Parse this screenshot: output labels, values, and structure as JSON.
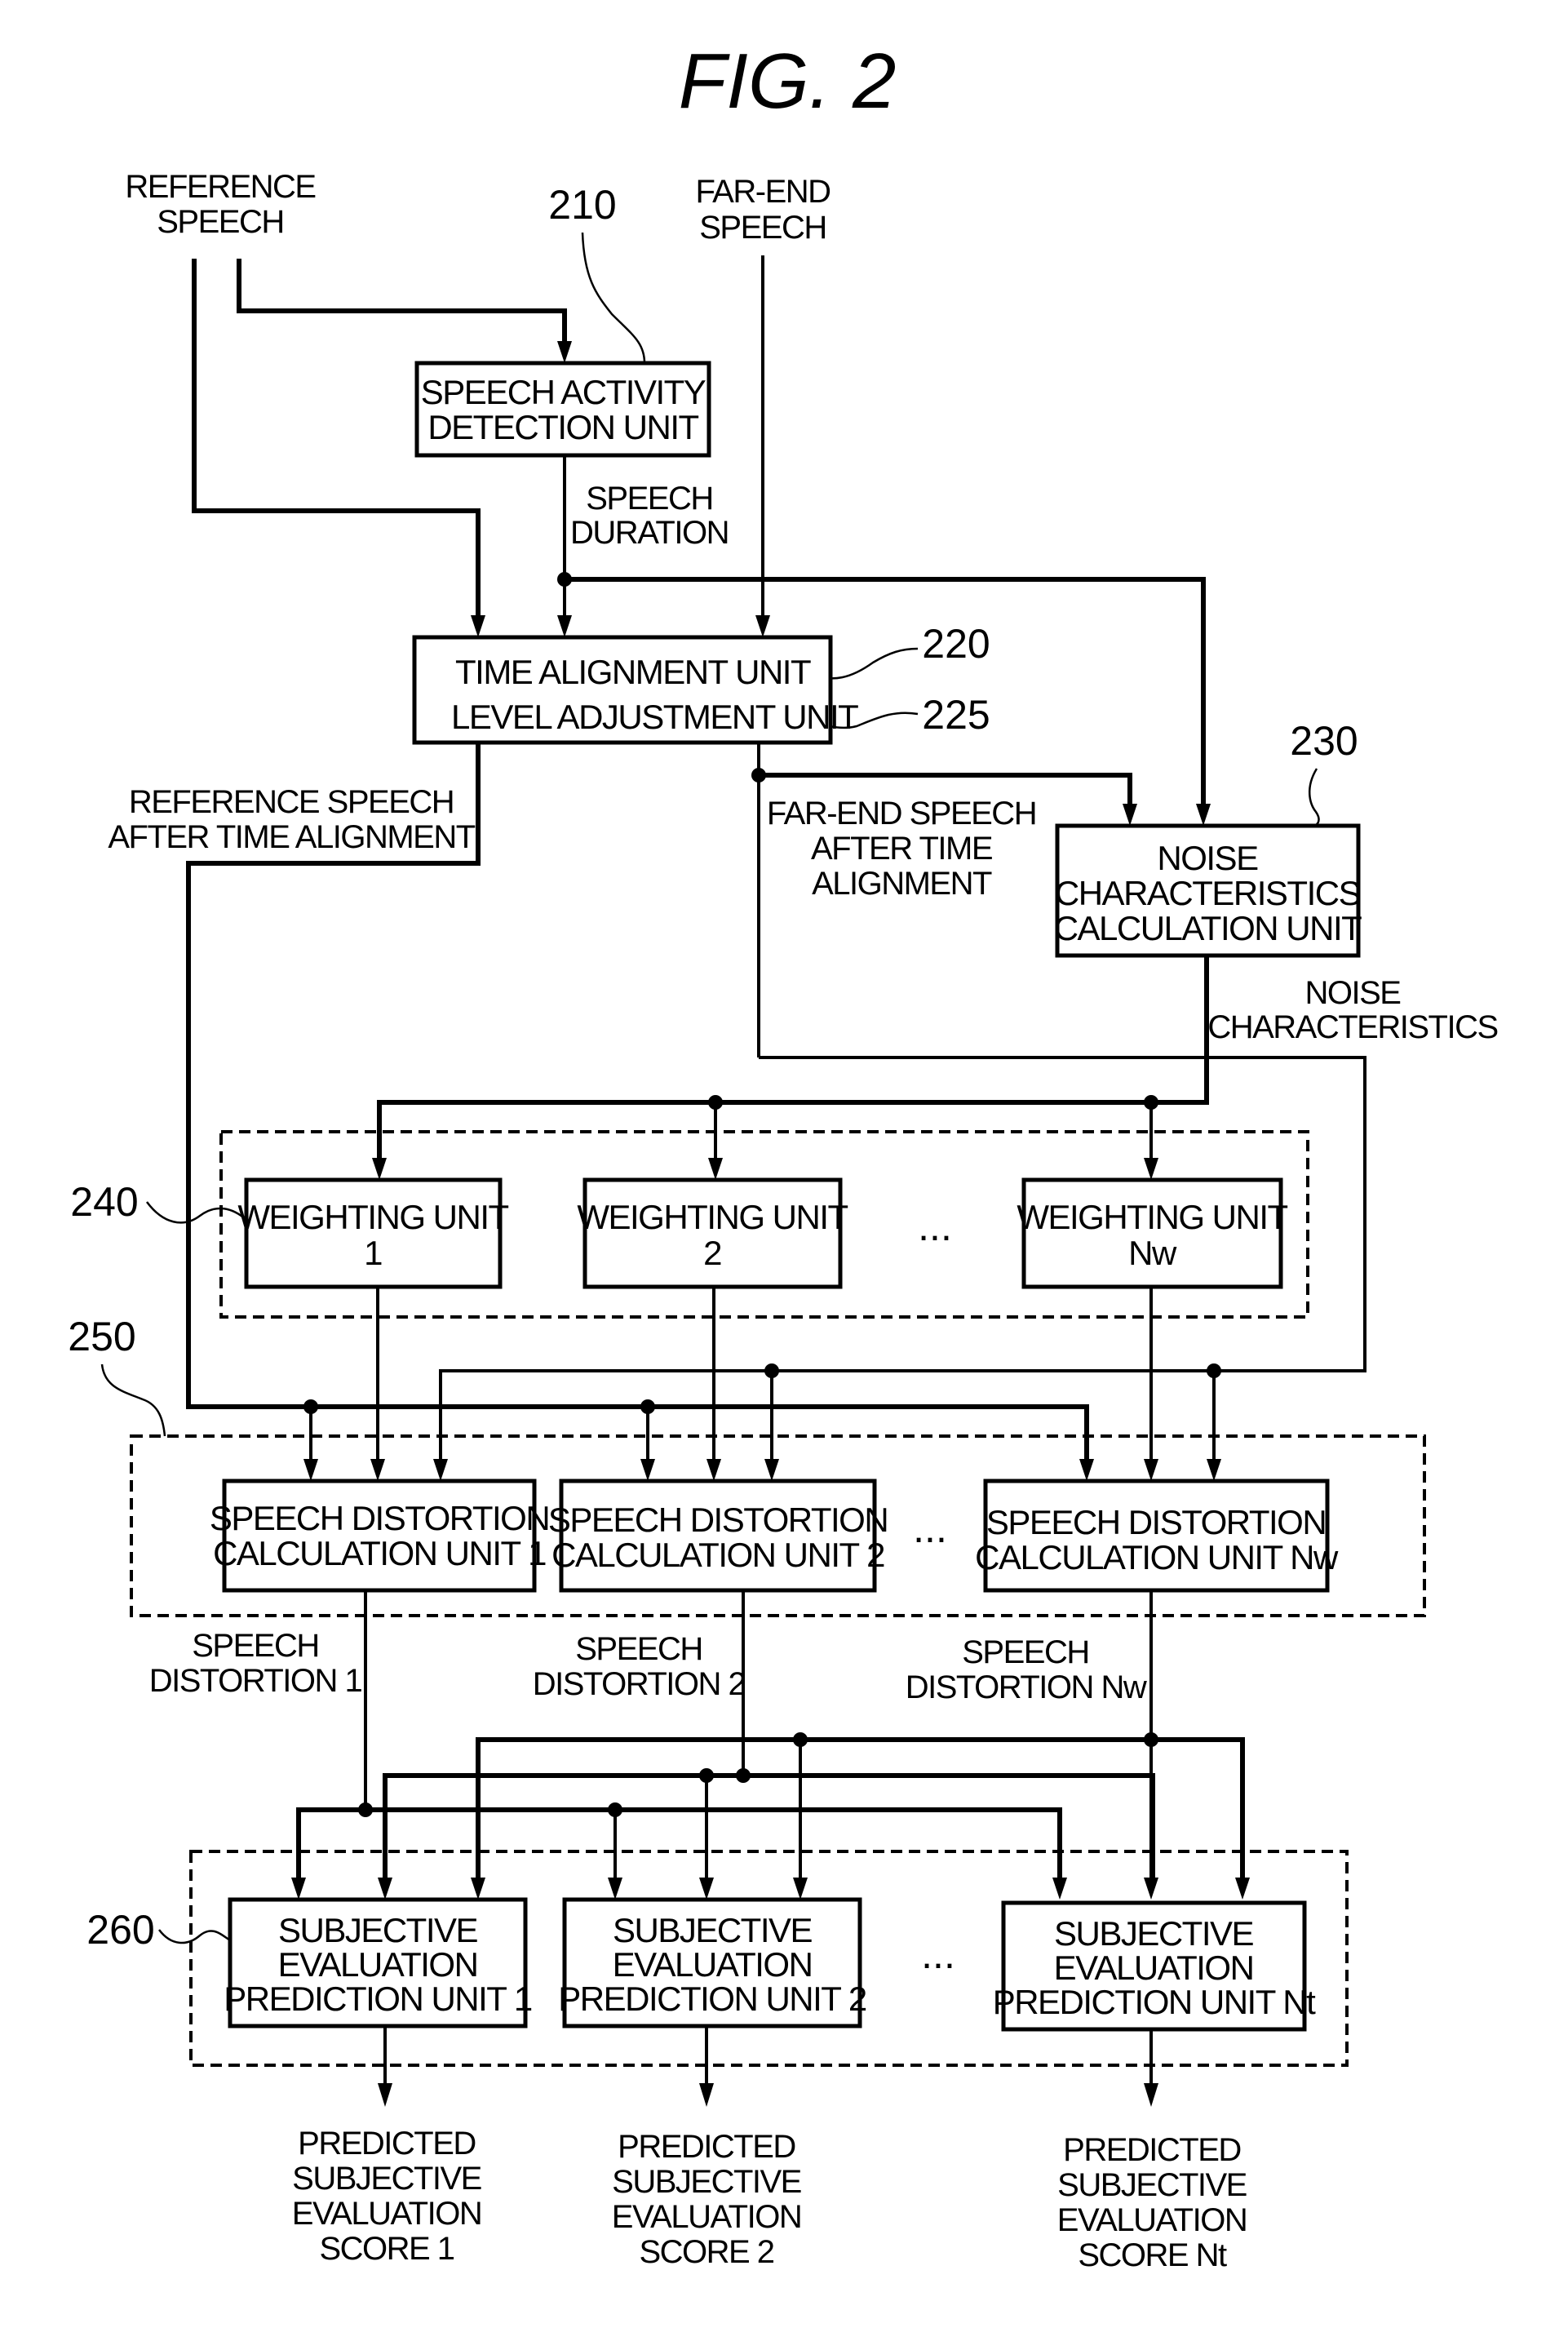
{
  "figure": {
    "title": "FIG.  2"
  },
  "inputs": {
    "reference_speech": [
      "REFERENCE",
      "SPEECH"
    ],
    "far_end_speech": [
      "FAR-END",
      "SPEECH"
    ]
  },
  "refs": {
    "r210": "210",
    "r220": "220",
    "r225": "225",
    "r230": "230",
    "r240": "240",
    "r250": "250",
    "r260": "260"
  },
  "boxes": {
    "speech_activity": [
      "SPEECH ACTIVITY",
      "DETECTION UNIT"
    ],
    "time_alignment": "TIME ALIGNMENT UNIT",
    "level_adjustment": "LEVEL ADJUSTMENT UNIT",
    "noise_calc": [
      "NOISE",
      "CHARACTERISTICS",
      "CALCULATION UNIT"
    ],
    "weighting": [
      [
        "WEIGHTING UNIT",
        "1"
      ],
      [
        "WEIGHTING UNIT",
        "2"
      ],
      [
        "WEIGHTING UNIT",
        "Nw"
      ]
    ],
    "distortion": [
      [
        "SPEECH DISTORTION",
        "CALCULATION UNIT 1"
      ],
      [
        "SPEECH DISTORTION",
        "CALCULATION UNIT 2"
      ],
      [
        "SPEECH DISTORTION",
        "CALCULATION UNIT Nw"
      ]
    ],
    "prediction": [
      [
        "SUBJECTIVE",
        "EVALUATION",
        "PREDICTION UNIT 1"
      ],
      [
        "SUBJECTIVE",
        "EVALUATION",
        "PREDICTION UNIT 2"
      ],
      [
        "SUBJECTIVE",
        "EVALUATION",
        "PREDICTION UNIT Nt"
      ]
    ]
  },
  "signals": {
    "speech_duration": [
      "SPEECH",
      "DURATION"
    ],
    "ref_after_ta": [
      "REFERENCE SPEECH",
      "AFTER TIME ALIGNMENT"
    ],
    "far_after_ta": [
      "FAR-END SPEECH",
      "AFTER TIME",
      "ALIGNMENT"
    ],
    "noise_characteristics": [
      "NOISE",
      "CHARACTERISTICS"
    ],
    "distortion_out": [
      [
        "SPEECH",
        "DISTORTION 1"
      ],
      [
        "SPEECH",
        "DISTORTION 2"
      ],
      [
        "SPEECH",
        "DISTORTION Nw"
      ]
    ],
    "scores": [
      [
        "PREDICTED",
        "SUBJECTIVE",
        "EVALUATION",
        "SCORE 1"
      ],
      [
        "PREDICTED",
        "SUBJECTIVE",
        "EVALUATION",
        "SCORE 2"
      ],
      [
        "PREDICTED",
        "SUBJECTIVE",
        "EVALUATION",
        "SCORE Nt"
      ]
    ]
  },
  "ellipsis": "..."
}
